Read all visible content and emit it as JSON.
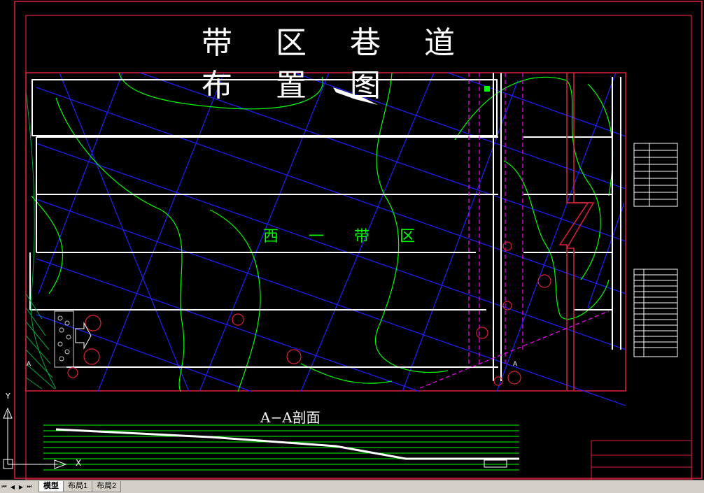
{
  "drawing": {
    "title": "带 区 巷 道 布 置 图",
    "zone_label": "西 一 带 区",
    "section_title": "A−A剖面",
    "section_marker_left": "A",
    "section_marker_right": "A"
  },
  "ucs": {
    "y_label": "Y",
    "x_label": "X"
  },
  "tabs": {
    "nav_first": "⏮",
    "nav_prev": "◀",
    "nav_next": "▶",
    "nav_last": "⏭",
    "items": [
      "模型",
      "布局1",
      "布局2"
    ]
  },
  "colors": {
    "background": "#000000",
    "frame": "#e0203a",
    "contour": "#00ff00",
    "grid": "#2020ff",
    "roadway": "#ffffff",
    "magenta": "#ff00ff"
  }
}
